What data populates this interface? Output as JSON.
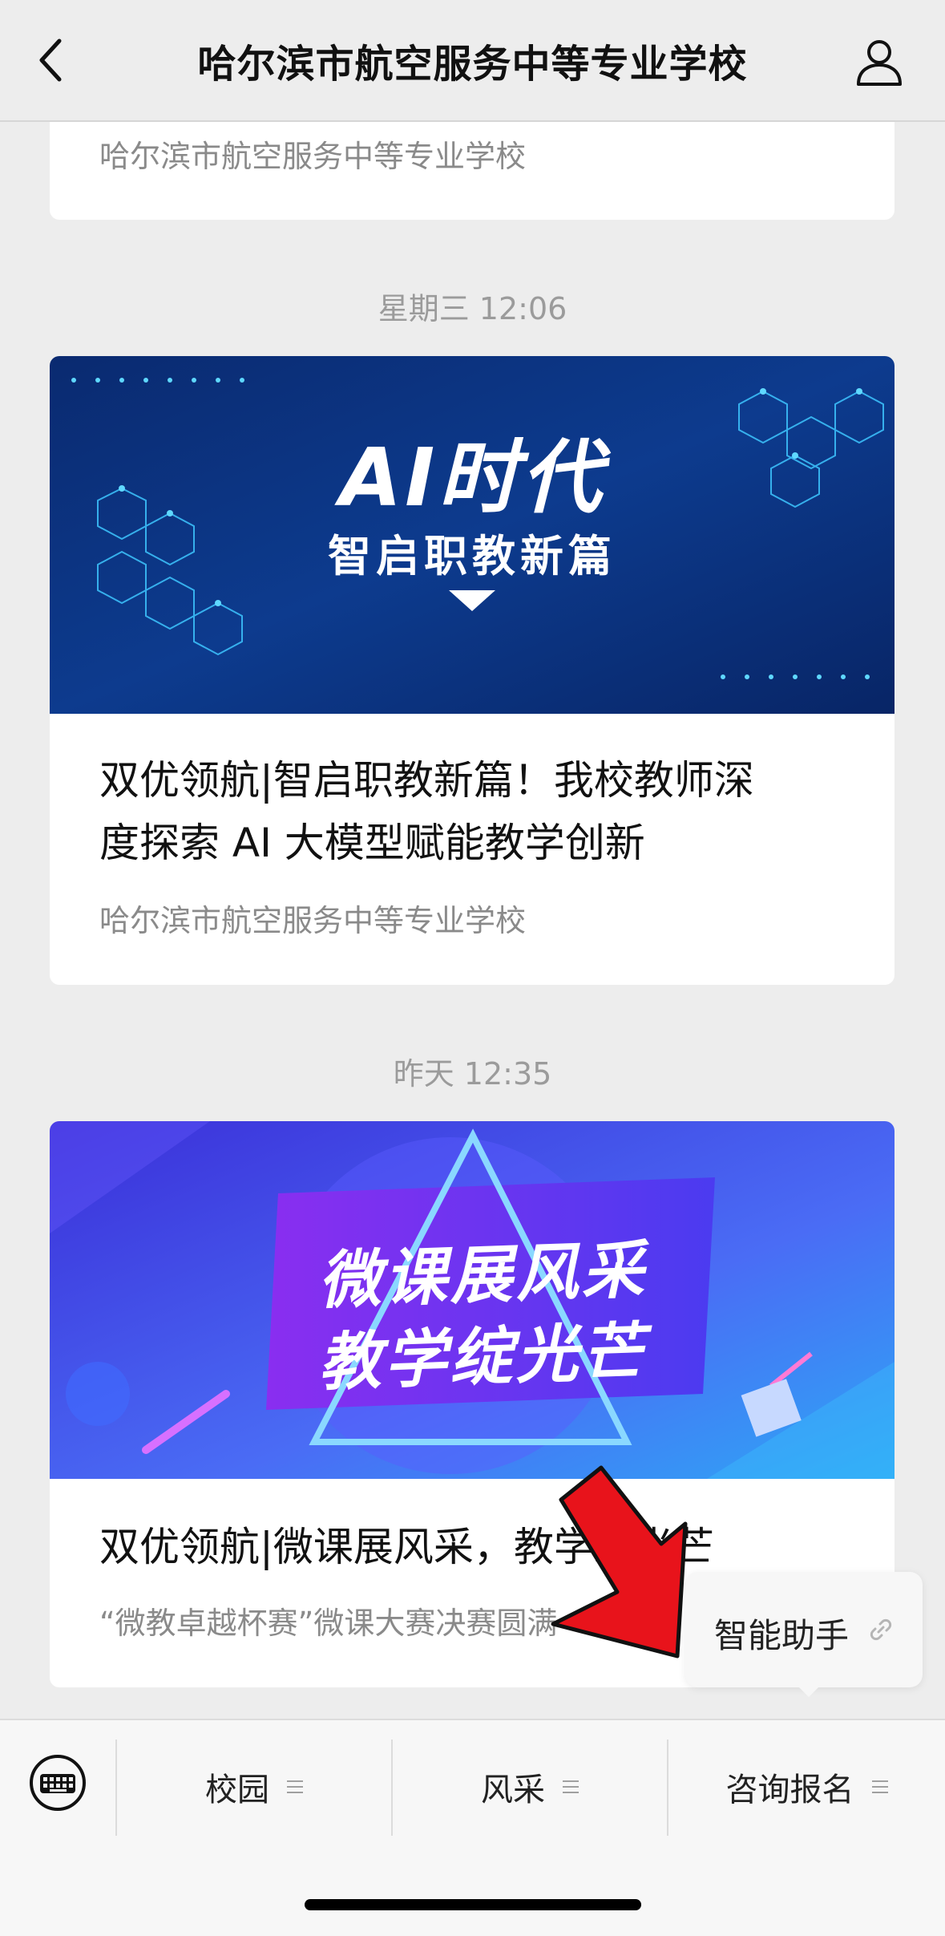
{
  "header": {
    "title": "哈尔滨市航空服务中等专业学校"
  },
  "cards": [
    {
      "source": "哈尔滨市航空服务中等专业学校"
    },
    {
      "banner_title": "AI时代",
      "banner_subtitle": "智启职教新篇",
      "headline_line1": "双优领航|智启职教新篇！我校教师深",
      "headline_line2": "度探索 AI 大模型赋能教学创新",
      "source": "哈尔滨市航空服务中等专业学校"
    },
    {
      "banner_title": "微课展风采",
      "banner_subtitle": "教学绽光芒",
      "headline": "双优领航|微课展风采，教学绽光芒",
      "summary": "“微教卓越杯赛”微课大赛决赛圆满"
    }
  ],
  "timestamps": [
    "星期三 12:06",
    "昨天 12:35"
  ],
  "popup": {
    "label": "智能助手"
  },
  "tabbar": {
    "tabs": [
      {
        "label": "校园"
      },
      {
        "label": "风采"
      },
      {
        "label": "咨询报名"
      }
    ]
  },
  "colors": {
    "background": "#ededed",
    "card": "#ffffff",
    "arrow": "#e8131b",
    "banner1": "#0b2d7a",
    "banner2": "#4a48e8"
  }
}
